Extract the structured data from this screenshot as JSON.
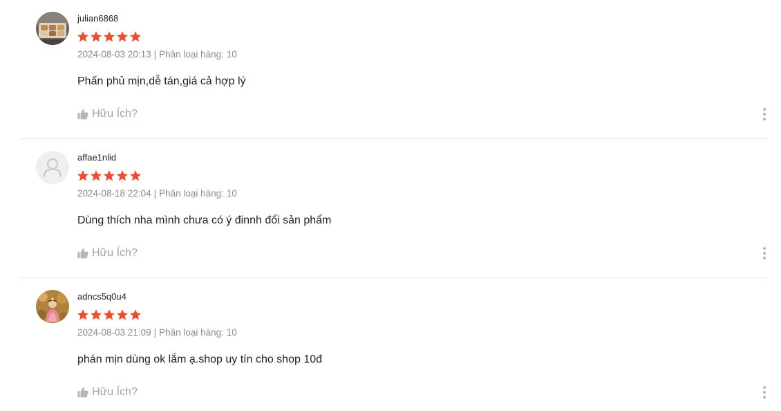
{
  "accent_color": "#ee4d2d",
  "reviews": [
    {
      "username": "julian6868",
      "rating": 5,
      "datetime": "2024-08-03 20:13",
      "variation": "Phân loại hàng: 10",
      "content": "Phấn phủ mịn,dễ tán,giá cả hợp lý",
      "helpful_label": "Hữu Ích?",
      "avatar_icon": "photo-avatar"
    },
    {
      "username": "affae1nlid",
      "rating": 5,
      "datetime": "2024-08-18 22:04",
      "variation": "Phân loại hàng: 10",
      "content": "Dùng thích nha mình chưa có ý đinnh đổi sản phẩm",
      "helpful_label": "Hữu Ích?",
      "avatar_icon": "default-user-icon"
    },
    {
      "username": "adncs5q0u4",
      "rating": 5,
      "datetime": "2024-08-03 21:09",
      "variation": "Phân loại hàng: 10",
      "content": "phán mịn dùng ok lắm ạ.shop uy tín cho shop 10đ",
      "helpful_label": "Hữu Ích?",
      "avatar_icon": "photo-avatar"
    }
  ]
}
